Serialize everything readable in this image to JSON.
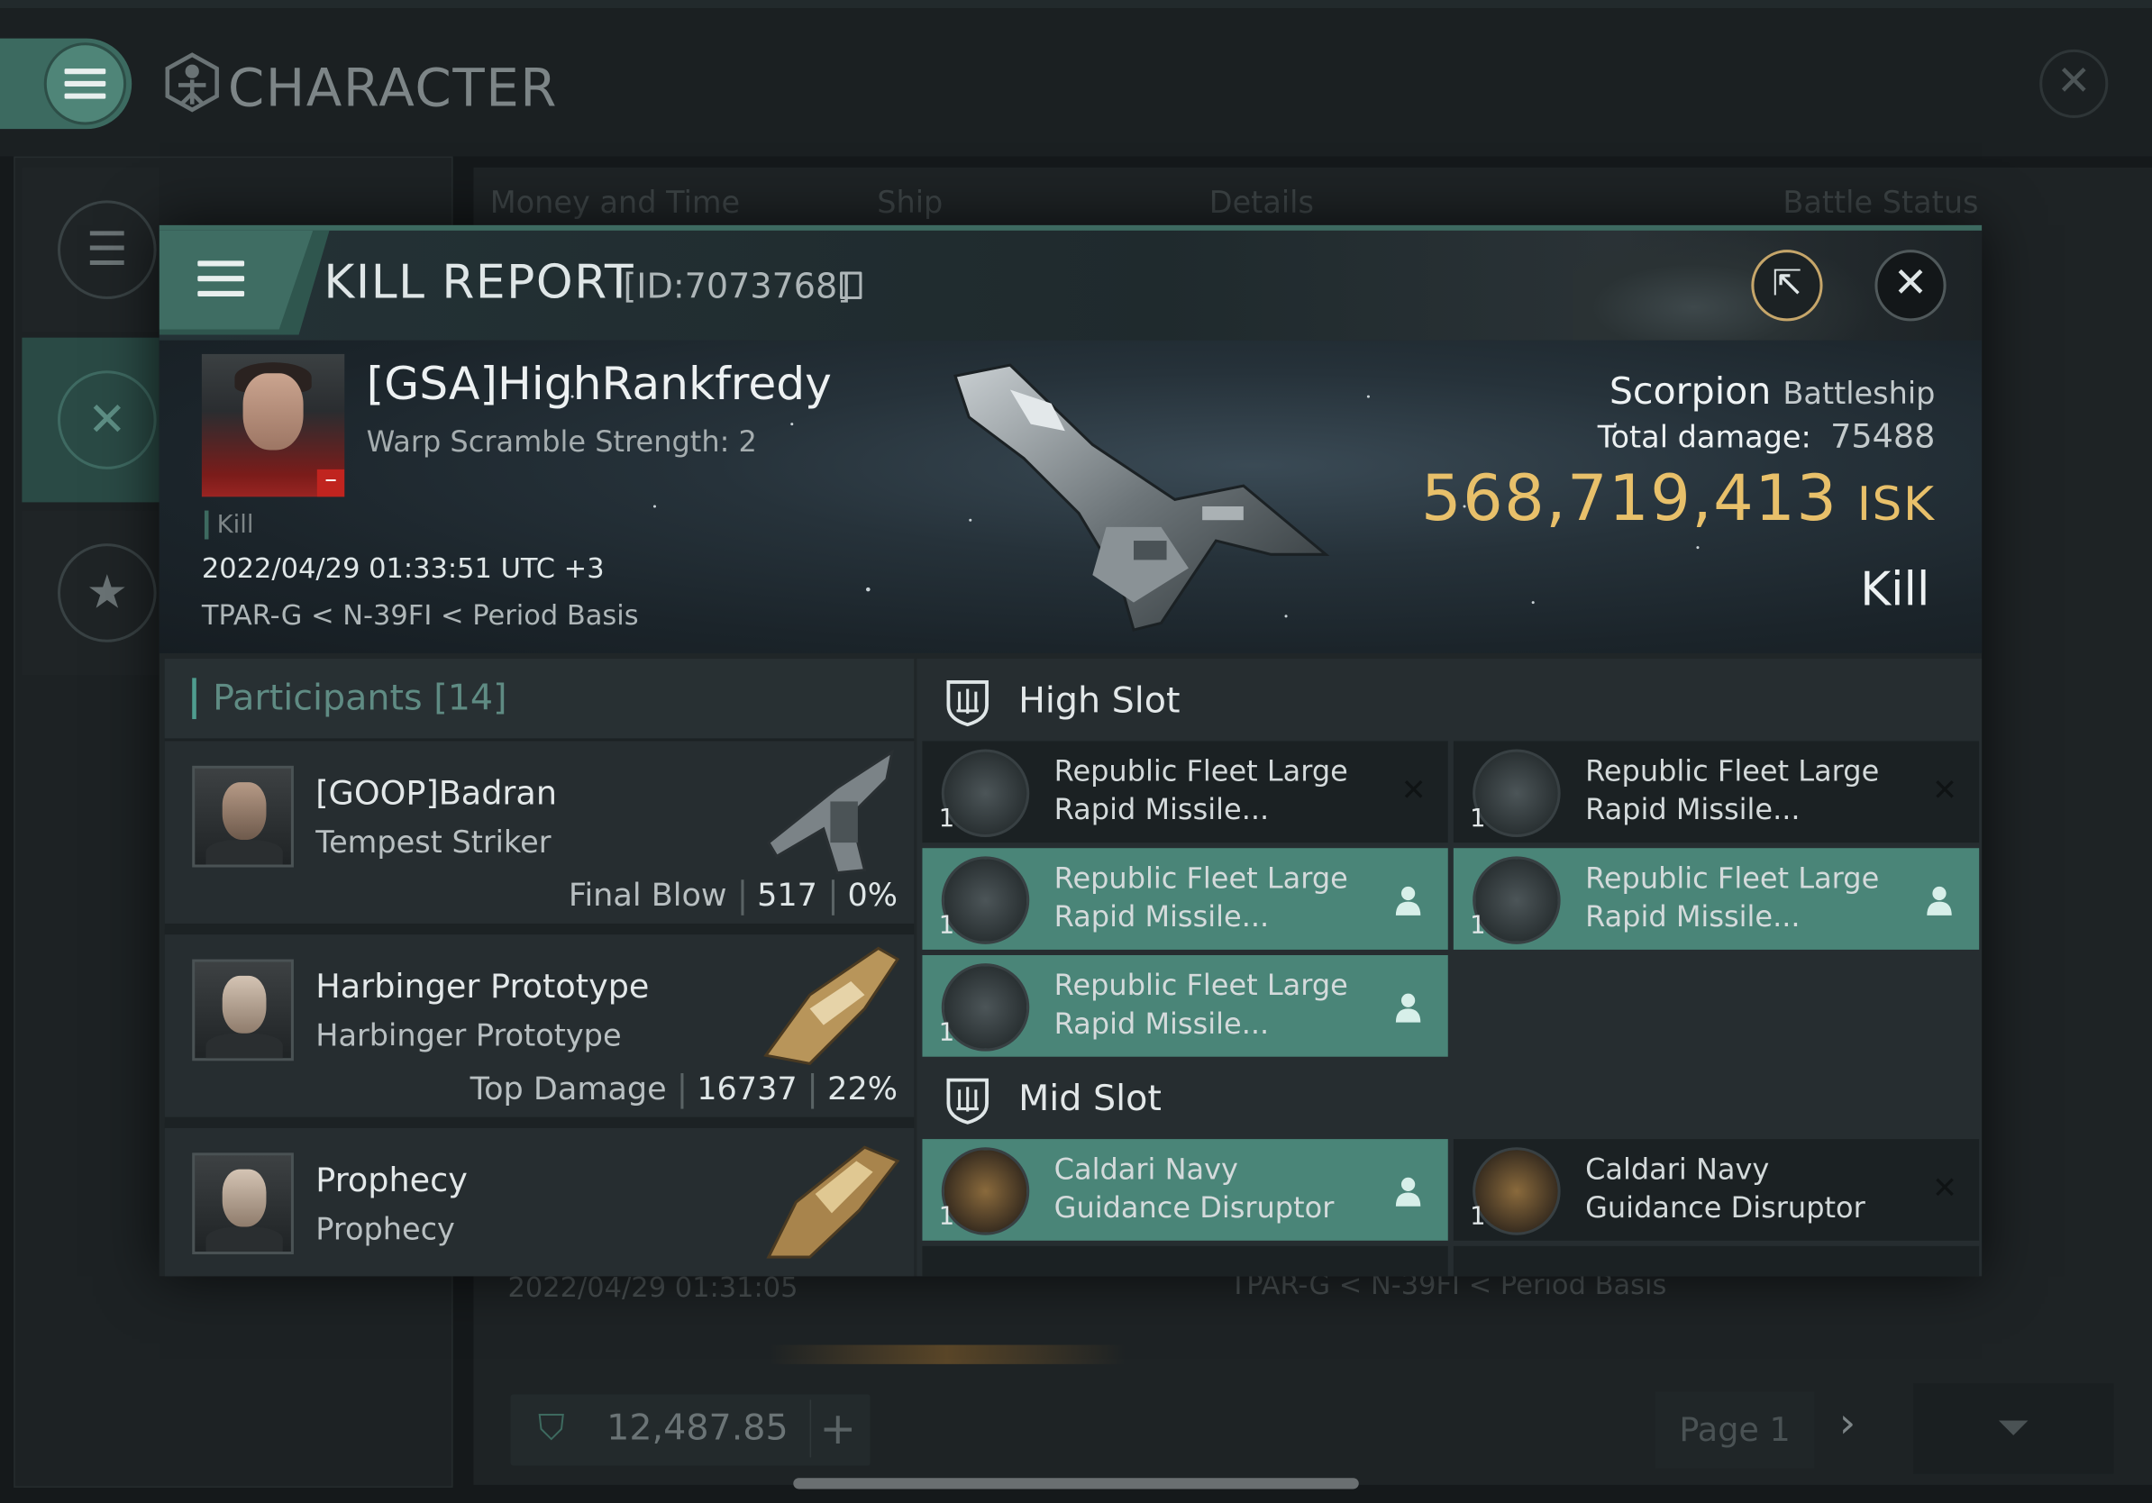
{
  "window": {
    "title": "CHARACTER"
  },
  "list_columns": [
    "Money and Time",
    "Ship",
    "Details",
    "Battle Status"
  ],
  "background_row": {
    "date": "2022/04/29  01:31:05",
    "location": "TPAR-G < N-39FI < Period Basis"
  },
  "wallet": {
    "value": "12,487.85"
  },
  "pager": {
    "label": "Page 1"
  },
  "kill_report": {
    "title": "KILL REPORT",
    "id": "[ID:7073768]",
    "victim": {
      "name": "[GSA]HighRankfredy",
      "warp_scramble": "Warp Scramble Strength: 2",
      "tag": "Kill",
      "datetime": "2022/04/29 01:33:51 UTC +3",
      "location": "TPAR-G < N-39FI < Period Basis"
    },
    "ship": {
      "name": "Scorpion",
      "class": "Battleship"
    },
    "total_damage_label": "Total damage:",
    "total_damage": "75488",
    "isk_value": "568,719,413",
    "isk_unit": "ISK",
    "result": "Kill"
  },
  "participants": {
    "header": "Participants [14]",
    "items": [
      {
        "name": "[GOOP]Badran",
        "ship": "Tempest Striker",
        "stat_label": "Final Blow",
        "damage": "517",
        "percent": "0%"
      },
      {
        "name": "Harbinger Prototype",
        "ship": "Harbinger Prototype",
        "stat_label": "Top Damage",
        "damage": "16737",
        "percent": "22%"
      },
      {
        "name": "Prophecy",
        "ship": "Prophecy"
      }
    ]
  },
  "fittings": {
    "high_slot_label": "High Slot",
    "mid_slot_label": "Mid Slot",
    "high_modules": [
      {
        "line1": "Republic Fleet Large",
        "line2": "Rapid Missile...",
        "qty": "1",
        "status": "destroyed"
      },
      {
        "line1": "Republic Fleet Large",
        "line2": "Rapid Missile...",
        "qty": "1",
        "status": "destroyed"
      },
      {
        "line1": "Republic Fleet Large",
        "line2": "Rapid Missile...",
        "qty": "1",
        "status": "dropped"
      },
      {
        "line1": "Republic Fleet Large",
        "line2": "Rapid Missile...",
        "qty": "1",
        "status": "dropped"
      },
      {
        "line1": "Republic Fleet Large",
        "line2": "Rapid Missile...",
        "qty": "1",
        "status": "dropped"
      }
    ],
    "mid_modules": [
      {
        "line1": "Caldari Navy",
        "line2": "Guidance Disruptor",
        "qty": "1",
        "status": "dropped"
      },
      {
        "line1": "Caldari Navy",
        "line2": "Guidance Disruptor",
        "qty": "1",
        "status": "destroyed"
      }
    ]
  },
  "colors": {
    "accent": "#4a8578",
    "isk": "#e8c06a",
    "header_tab": "#3f6d63"
  }
}
